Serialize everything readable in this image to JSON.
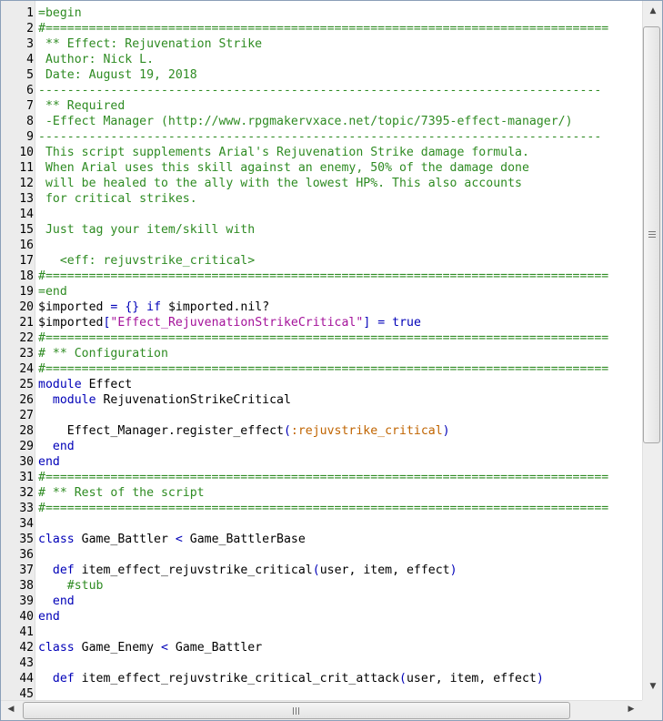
{
  "editor": {
    "lines": [
      {
        "n": "1",
        "t": [
          [
            "c",
            "=begin"
          ]
        ]
      },
      {
        "n": "2",
        "t": [
          [
            "c",
            "#=============================================================================="
          ]
        ]
      },
      {
        "n": "3",
        "t": [
          [
            "c",
            " ** Effect: Rejuvenation Strike"
          ]
        ]
      },
      {
        "n": "4",
        "t": [
          [
            "c",
            " Author: Nick L."
          ]
        ]
      },
      {
        "n": "5",
        "t": [
          [
            "c",
            " Date: August 19, 2018"
          ]
        ]
      },
      {
        "n": "6",
        "t": [
          [
            "c",
            "------------------------------------------------------------------------------"
          ]
        ]
      },
      {
        "n": "7",
        "t": [
          [
            "c",
            " ** Required"
          ]
        ]
      },
      {
        "n": "8",
        "t": [
          [
            "c",
            " -Effect Manager (http://www.rpgmakervxace.net/topic/7395-effect-manager/)"
          ]
        ]
      },
      {
        "n": "9",
        "t": [
          [
            "c",
            "------------------------------------------------------------------------------"
          ]
        ]
      },
      {
        "n": "10",
        "t": [
          [
            "c",
            " This script supplements Arial's Rejuvenation Strike damage formula."
          ]
        ]
      },
      {
        "n": "11",
        "t": [
          [
            "c",
            " When Arial uses this skill against an enemy, 50% of the damage done"
          ]
        ]
      },
      {
        "n": "12",
        "t": [
          [
            "c",
            " will be healed to the ally with the lowest HP%. This also accounts"
          ]
        ]
      },
      {
        "n": "13",
        "t": [
          [
            "c",
            " for critical strikes."
          ]
        ]
      },
      {
        "n": "14",
        "t": []
      },
      {
        "n": "15",
        "t": [
          [
            "c",
            " Just tag your item/skill with"
          ]
        ]
      },
      {
        "n": "16",
        "t": []
      },
      {
        "n": "17",
        "t": [
          [
            "c",
            "   <eff: rejuvstrike_critical>"
          ]
        ]
      },
      {
        "n": "18",
        "t": [
          [
            "c",
            "#=============================================================================="
          ]
        ]
      },
      {
        "n": "19",
        "t": [
          [
            "c",
            "=end"
          ]
        ]
      },
      {
        "n": "20",
        "t": [
          [
            "p",
            "$imported "
          ],
          [
            "o",
            "="
          ],
          [
            "p",
            " "
          ],
          [
            "o",
            "{}"
          ],
          [
            "p",
            " "
          ],
          [
            "k",
            "if"
          ],
          [
            "p",
            " $imported.nil?"
          ]
        ]
      },
      {
        "n": "21",
        "t": [
          [
            "p",
            "$imported"
          ],
          [
            "o",
            "["
          ],
          [
            "s",
            "\"Effect_RejuvenationStrikeCritical\""
          ],
          [
            "o",
            "]"
          ],
          [
            "p",
            " "
          ],
          [
            "o",
            "="
          ],
          [
            "p",
            " "
          ],
          [
            "k",
            "true"
          ]
        ]
      },
      {
        "n": "22",
        "t": [
          [
            "c",
            "#=============================================================================="
          ]
        ]
      },
      {
        "n": "23",
        "t": [
          [
            "c",
            "# ** Configuration"
          ]
        ]
      },
      {
        "n": "24",
        "t": [
          [
            "c",
            "#=============================================================================="
          ]
        ]
      },
      {
        "n": "25",
        "t": [
          [
            "k",
            "module"
          ],
          [
            "p",
            " Effect"
          ]
        ]
      },
      {
        "n": "26",
        "t": [
          [
            "p",
            "  "
          ],
          [
            "k",
            "module"
          ],
          [
            "p",
            " RejuvenationStrikeCritical"
          ]
        ]
      },
      {
        "n": "27",
        "t": []
      },
      {
        "n": "28",
        "t": [
          [
            "p",
            "    Effect_Manager.register_effect"
          ],
          [
            "o",
            "("
          ],
          [
            "sym",
            ":rejuvstrike_critical"
          ],
          [
            "o",
            ")"
          ]
        ]
      },
      {
        "n": "29",
        "t": [
          [
            "p",
            "  "
          ],
          [
            "k",
            "end"
          ]
        ]
      },
      {
        "n": "30",
        "t": [
          [
            "k",
            "end"
          ]
        ]
      },
      {
        "n": "31",
        "t": [
          [
            "c",
            "#=============================================================================="
          ]
        ]
      },
      {
        "n": "32",
        "t": [
          [
            "c",
            "# ** Rest of the script"
          ]
        ]
      },
      {
        "n": "33",
        "t": [
          [
            "c",
            "#=============================================================================="
          ]
        ]
      },
      {
        "n": "34",
        "t": []
      },
      {
        "n": "35",
        "t": [
          [
            "k",
            "class"
          ],
          [
            "p",
            " Game_Battler "
          ],
          [
            "o",
            "<"
          ],
          [
            "p",
            " Game_BattlerBase"
          ]
        ]
      },
      {
        "n": "36",
        "t": []
      },
      {
        "n": "37",
        "t": [
          [
            "p",
            "  "
          ],
          [
            "k",
            "def"
          ],
          [
            "p",
            " item_effect_rejuvstrike_critical"
          ],
          [
            "o",
            "("
          ],
          [
            "p",
            "user, item, effect"
          ],
          [
            "o",
            ")"
          ]
        ]
      },
      {
        "n": "38",
        "t": [
          [
            "p",
            "    "
          ],
          [
            "c",
            "#stub"
          ]
        ]
      },
      {
        "n": "39",
        "t": [
          [
            "p",
            "  "
          ],
          [
            "k",
            "end"
          ]
        ]
      },
      {
        "n": "40",
        "t": [
          [
            "k",
            "end"
          ]
        ]
      },
      {
        "n": "41",
        "t": []
      },
      {
        "n": "42",
        "t": [
          [
            "k",
            "class"
          ],
          [
            "p",
            " Game_Enemy "
          ],
          [
            "o",
            "<"
          ],
          [
            "p",
            " Game_Battler"
          ]
        ]
      },
      {
        "n": "43",
        "t": []
      },
      {
        "n": "44",
        "t": [
          [
            "p",
            "  "
          ],
          [
            "k",
            "def"
          ],
          [
            "p",
            " item_effect_rejuvstrike_critical_crit_attack"
          ],
          [
            "o",
            "("
          ],
          [
            "p",
            "user, item, effect"
          ],
          [
            "o",
            ")"
          ]
        ]
      },
      {
        "n": "45",
        "t": []
      }
    ]
  },
  "scrollbars": {
    "up_arrow": "▲",
    "down_arrow": "▼",
    "left_arrow": "◀",
    "right_arrow": "▶"
  }
}
